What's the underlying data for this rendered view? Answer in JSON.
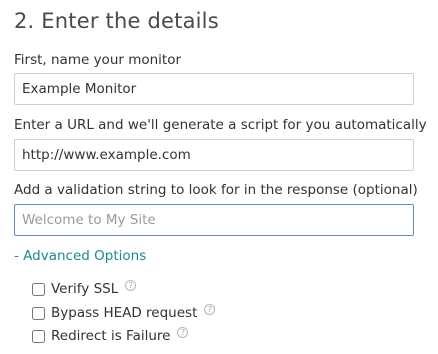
{
  "heading": "2. Enter the details",
  "name_field": {
    "label": "First, name your monitor",
    "value": "Example Monitor"
  },
  "url_field": {
    "label": "Enter a URL and we'll generate a script for you automatically",
    "value": "http://www.example.com"
  },
  "validation_field": {
    "label": "Add a validation string to look for in the response (optional)",
    "placeholder": "Welcome to My Site",
    "value": ""
  },
  "advanced_toggle": "- Advanced Options",
  "options": [
    {
      "label": "Verify SSL",
      "checked": false,
      "icon": "help-icon"
    },
    {
      "label": "Bypass HEAD request",
      "checked": false,
      "icon": "help-icon"
    },
    {
      "label": "Redirect is Failure",
      "checked": false,
      "icon": "help-icon"
    }
  ],
  "help_glyph": "?",
  "colors": {
    "link": "#1a8a8a",
    "focus_border": "#6b8ab3"
  }
}
